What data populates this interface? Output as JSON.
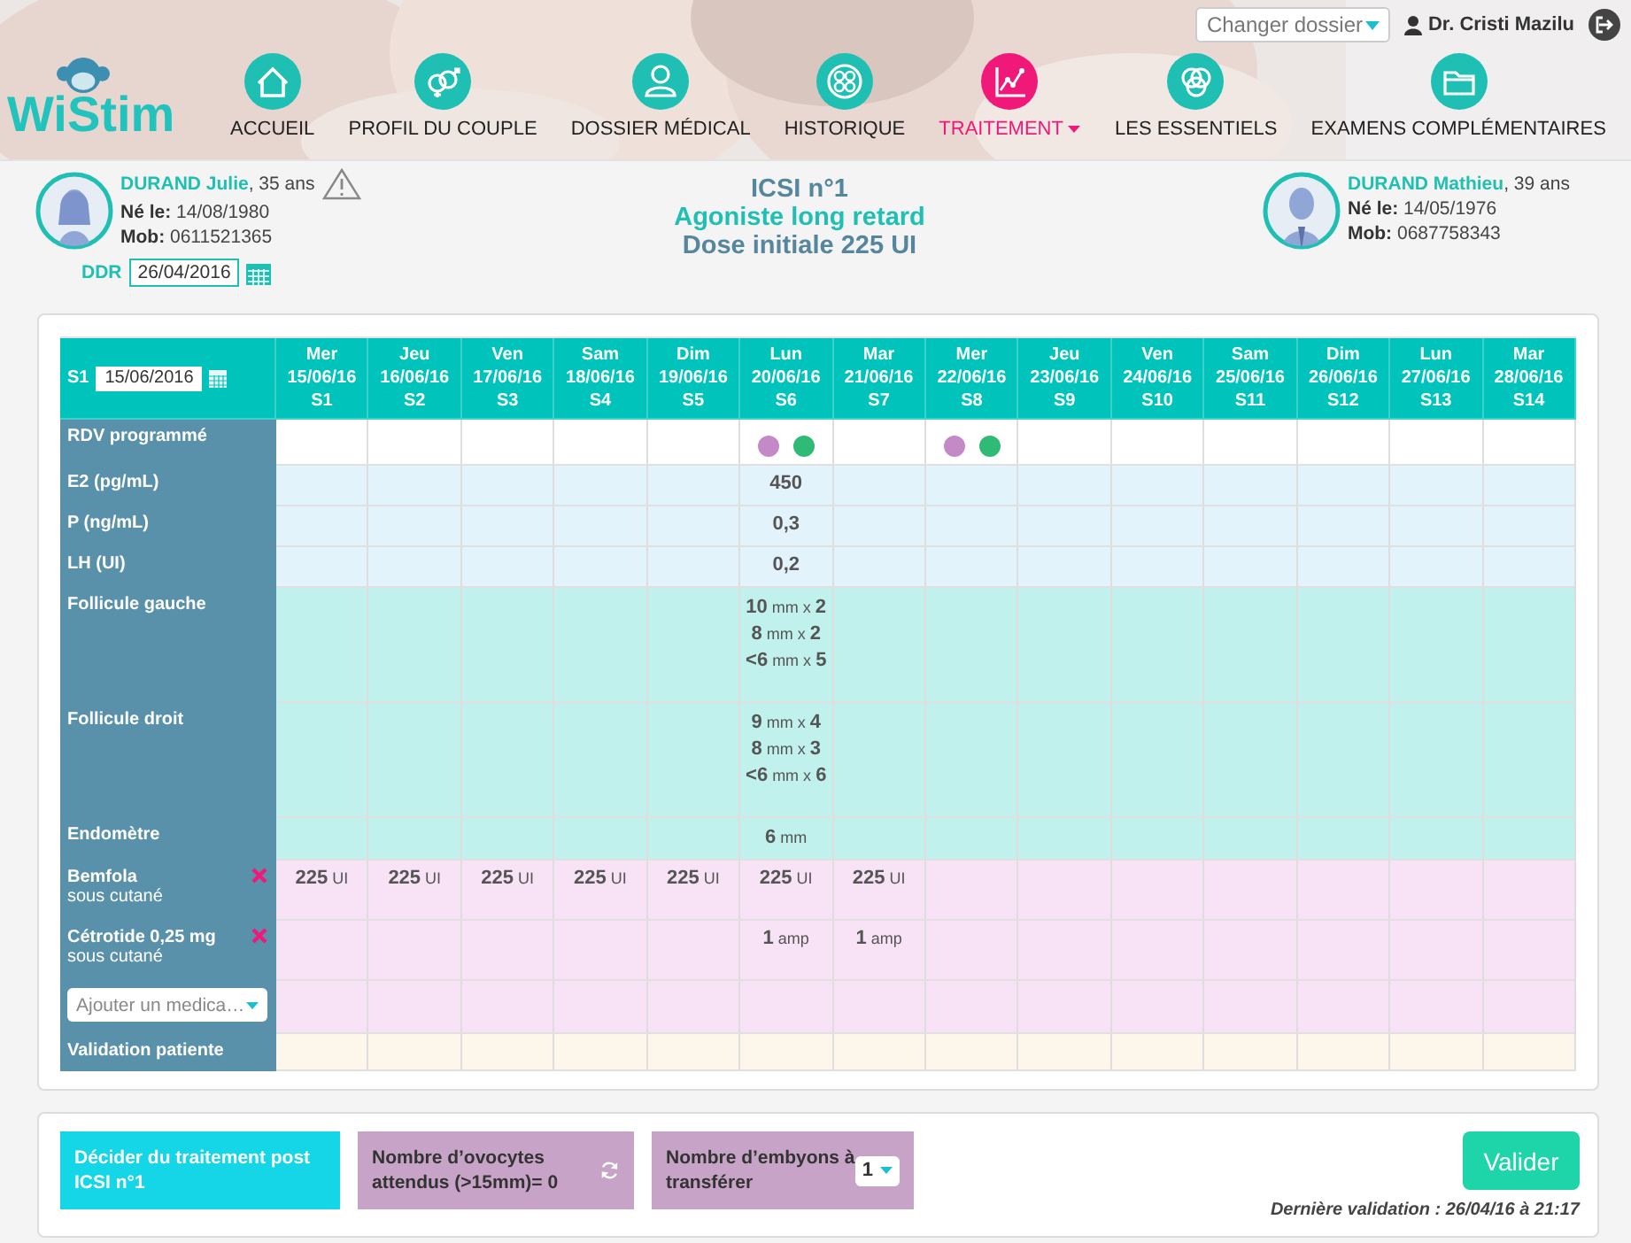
{
  "header": {
    "logo": "WiStim",
    "folder_select": {
      "placeholder": "Changer dossier"
    },
    "user": "Dr. Cristi Mazilu",
    "nav": [
      {
        "label": "ACCUEIL",
        "selected": false
      },
      {
        "label": "PROFIL DU COUPLE",
        "selected": false
      },
      {
        "label": "DOSSIER MÉDICAL",
        "selected": false
      },
      {
        "label": "HISTORIQUE",
        "selected": false
      },
      {
        "label": "TRAITEMENT",
        "selected": true
      },
      {
        "label": "LES ESSENTIELS",
        "selected": false
      },
      {
        "label": "EXAMENS COMPLÉMENTAIRES",
        "selected": false
      }
    ]
  },
  "patients": {
    "female": {
      "name": "DURAND Julie",
      "age": ", 35 ans",
      "warning": true,
      "details": [
        {
          "label": "Né le:",
          "value": "14/08/1980"
        },
        {
          "label": "Mob:",
          "value": "0611521365"
        }
      ],
      "ddr_label": "DDR",
      "ddr": "26/04/2016"
    },
    "male": {
      "name": "DURAND Mathieu",
      "age": ", 39 ans",
      "warning": false,
      "details": [
        {
          "label": "Né le:",
          "value": "14/05/1976"
        },
        {
          "label": "Mob:",
          "value": "0687758343"
        }
      ]
    }
  },
  "protocol": [
    "ICSI n°1",
    "Agoniste long retard",
    "Dose initiale 225 UI"
  ],
  "table": {
    "start_label": "S1",
    "start_date": "15/06/2016",
    "columns": [
      {
        "day": "Mer",
        "date": "15/06/16",
        "label": "S1"
      },
      {
        "day": "Jeu",
        "date": "16/06/16",
        "label": "S2"
      },
      {
        "day": "Ven",
        "date": "17/06/16",
        "label": "S3"
      },
      {
        "day": "Sam",
        "date": "18/06/16",
        "label": "S4"
      },
      {
        "day": "Dim",
        "date": "19/06/16",
        "label": "S5"
      },
      {
        "day": "Lun",
        "date": "20/06/16",
        "label": "S6"
      },
      {
        "day": "Mar",
        "date": "21/06/16",
        "label": "S7"
      },
      {
        "day": "Mer",
        "date": "22/06/16",
        "label": "S8"
      },
      {
        "day": "Jeu",
        "date": "23/06/16",
        "label": "S9"
      },
      {
        "day": "Ven",
        "date": "24/06/16",
        "label": "S10"
      },
      {
        "day": "Sam",
        "date": "25/06/16",
        "label": "S11"
      },
      {
        "day": "Dim",
        "date": "26/06/16",
        "label": "S12"
      },
      {
        "day": "Lun",
        "date": "27/06/16",
        "label": "S13"
      },
      {
        "day": "Mar",
        "date": "28/06/16",
        "label": "S14"
      }
    ],
    "rows": [
      {
        "kind": "appointments",
        "label": "RDV programmé",
        "cells": [
          null,
          null,
          null,
          null,
          null,
          [
            {
              "color": "#c48ac8"
            },
            {
              "color": "#2fba76"
            }
          ],
          null,
          [
            {
              "color": "#c48ac8"
            },
            {
              "color": "#2fba76"
            }
          ],
          null,
          null,
          null,
          null,
          null,
          null
        ]
      },
      {
        "kind": "hormone",
        "label": "E2 (pg/mL)",
        "cells": [
          null,
          null,
          null,
          null,
          null,
          "450",
          null,
          null,
          null,
          null,
          null,
          null,
          null,
          null
        ]
      },
      {
        "kind": "hormone",
        "label": "P (ng/mL)",
        "cells": [
          null,
          null,
          null,
          null,
          null,
          "0,3",
          null,
          null,
          null,
          null,
          null,
          null,
          null,
          null
        ]
      },
      {
        "kind": "hormone",
        "label": "LH (UI)",
        "cells": [
          null,
          null,
          null,
          null,
          null,
          "0,2",
          null,
          null,
          null,
          null,
          null,
          null,
          null,
          null
        ]
      },
      {
        "kind": "ultrasound",
        "label": "Follicule gauche",
        "cells": [
          null,
          null,
          null,
          null,
          null,
          [
            "**10** mm x **2**",
            "**8** mm x **2**",
            "**<6** mm x **5**"
          ],
          null,
          null,
          null,
          null,
          null,
          null,
          null,
          null
        ]
      },
      {
        "kind": "ultrasound",
        "label": "Follicule droit",
        "cells": [
          null,
          null,
          null,
          null,
          null,
          [
            "**9** mm x **4**",
            "**8** mm x **3**",
            "**<6** mm x **6**"
          ],
          null,
          null,
          null,
          null,
          null,
          null,
          null,
          null
        ]
      },
      {
        "kind": "ultrasound",
        "label": "Endomètre",
        "cells": [
          null,
          null,
          null,
          null,
          null,
          [
            "**6** mm"
          ],
          null,
          null,
          null,
          null,
          null,
          null,
          null,
          null
        ]
      },
      {
        "kind": "medication",
        "label": "Bemfola",
        "route": "sous cutané",
        "removable": true,
        "cells": [
          "**225** UI",
          "**225** UI",
          "**225** UI",
          "**225** UI",
          "**225** UI",
          "**225** UI",
          "**225** UI",
          null,
          null,
          null,
          null,
          null,
          null,
          null
        ]
      },
      {
        "kind": "medication",
        "label": "Cétrotide 0,25 mg",
        "route": "sous cutané",
        "removable": true,
        "cells": [
          null,
          null,
          null,
          null,
          null,
          "**1** amp",
          "**1** amp",
          null,
          null,
          null,
          null,
          null,
          null,
          null
        ]
      },
      {
        "kind": "add",
        "placeholder": "Ajouter un medica…"
      },
      {
        "kind": "validation",
        "label": "Validation patiente"
      }
    ]
  },
  "footer": {
    "actions": [
      {
        "kind": "decision",
        "text": "Décider du traitement post ICSI n°1"
      },
      {
        "kind": "counter",
        "text": "Nombre d’ovocytes attendus (>15mm)= 0"
      },
      {
        "kind": "select",
        "text": "Nombre d’embyons à transférer",
        "value": "1"
      }
    ],
    "button": "Valider",
    "last_validation": "Dernière validation : 26/04/16 à 21:17"
  }
}
